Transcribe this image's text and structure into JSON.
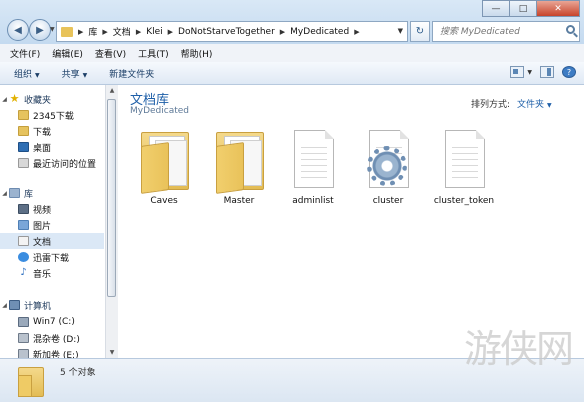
{
  "address": {
    "crumbs": [
      "库",
      "文档",
      "Klei",
      "DoNotStarveTogether",
      "MyDedicated"
    ]
  },
  "search": {
    "placeholder": "搜索 MyDedicated"
  },
  "window_buttons": {
    "minimize": "—",
    "maximize": "□",
    "close": "✕"
  },
  "menubar": [
    "文件(F)",
    "编辑(E)",
    "查看(V)",
    "工具(T)",
    "帮助(H)"
  ],
  "toolbar": {
    "organize": "组织",
    "share": "共享",
    "new_folder": "新建文件夹"
  },
  "sidebar": {
    "favorites": {
      "title": "收藏夹",
      "items": [
        "2345下载",
        "下载",
        "桌面",
        "最近访问的位置"
      ]
    },
    "libraries": {
      "title": "库",
      "items": [
        "视频",
        "图片",
        "文档",
        "迅雷下载",
        "音乐"
      ]
    },
    "computer": {
      "title": "计算机",
      "items": [
        "Win7 (C:)",
        "混杂卷 (D:)",
        "新加卷 (E:)"
      ]
    }
  },
  "content": {
    "title": "文档库",
    "subtitle": "MyDedicated",
    "arrange_label": "排列方式:",
    "arrange_value": "文件夹",
    "items": [
      {
        "name": "Caves",
        "icon": "folder-icon"
      },
      {
        "name": "Master",
        "icon": "folder-icon"
      },
      {
        "name": "adminlist",
        "icon": "file-icon"
      },
      {
        "name": "cluster",
        "icon": "config-file-icon"
      },
      {
        "name": "cluster_token",
        "icon": "file-icon"
      }
    ]
  },
  "status": {
    "text": "5 个对象"
  },
  "watermark": "游侠网"
}
